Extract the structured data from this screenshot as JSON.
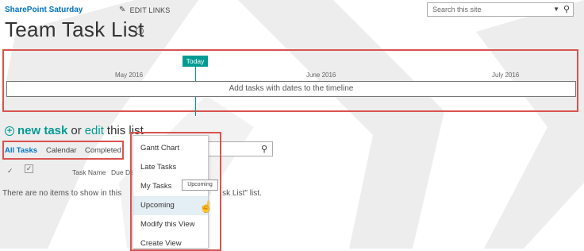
{
  "header": {
    "site_title": "SharePoint Saturday",
    "edit_links": "EDIT LINKS",
    "search_placeholder": "Search this site"
  },
  "page_title": "Team Task List",
  "timeline": {
    "today_label": "Today",
    "months": [
      "May 2016",
      "June 2016",
      "July 2016"
    ],
    "empty_text": "Add tasks with dates to the timeline"
  },
  "actions": {
    "new_task": "new task",
    "or_text": "or",
    "edit_text": "edit",
    "this_list": "this list"
  },
  "views": {
    "items": [
      "All Tasks",
      "Calendar",
      "Completed"
    ],
    "active": "All Tasks"
  },
  "columns": {
    "task_name": "Task Name",
    "due_date": "Due Date"
  },
  "empty_message": {
    "start": "There are no items to show in this",
    "end": "sk List\" list."
  },
  "view_menu": {
    "items": [
      "Gantt Chart",
      "Late Tasks",
      "My Tasks",
      "Upcoming",
      "Modify this View",
      "Create View"
    ],
    "hovered": "Upcoming",
    "tooltip": "Upcoming"
  },
  "colors": {
    "accent": "#009b92",
    "link": "#0072c6",
    "highlight_border": "#d9534f"
  },
  "icons": [
    "pencil-icon",
    "dropdown-caret-icon",
    "search-icon",
    "info-icon",
    "add-icon",
    "checkmark-icon",
    "select-all-checkbox-icon",
    "hand-cursor-icon"
  ]
}
